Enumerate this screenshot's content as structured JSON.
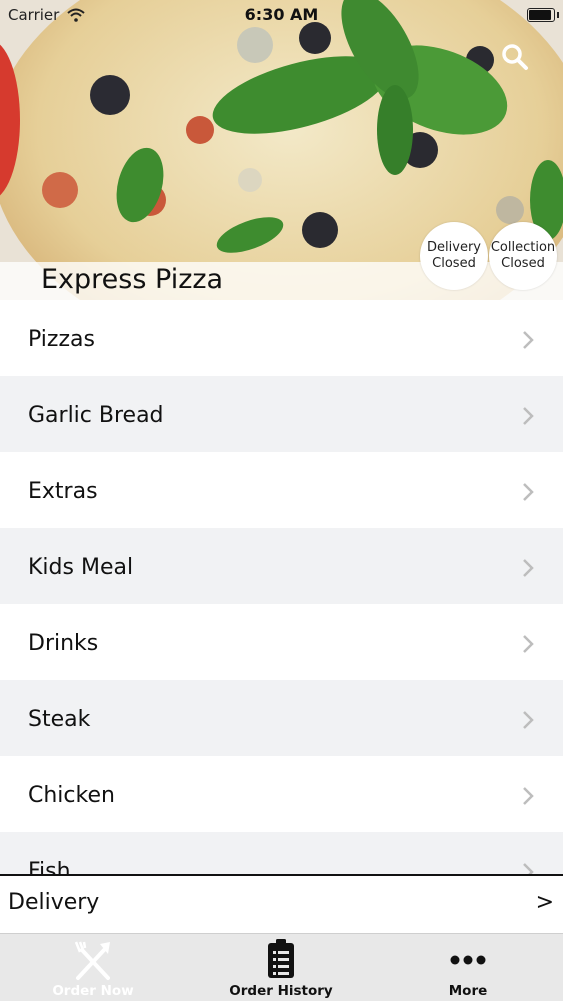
{
  "status_bar": {
    "carrier": "Carrier",
    "time": "6:30 AM",
    "battery_level": 0.9
  },
  "header": {
    "restaurant_name": "Express Pizza",
    "search_icon": "search-icon"
  },
  "badges": {
    "delivery": {
      "line1": "Delivery",
      "line2": "Closed"
    },
    "collection": {
      "line1": "Collection",
      "line2": "Closed"
    }
  },
  "menu": {
    "items": [
      {
        "label": "Pizzas"
      },
      {
        "label": "Garlic Bread"
      },
      {
        "label": "Extras"
      },
      {
        "label": "Kids Meal"
      },
      {
        "label": "Drinks"
      },
      {
        "label": "Steak"
      },
      {
        "label": "Chicken"
      },
      {
        "label": "Fish"
      }
    ]
  },
  "delivery_bar": {
    "label": "Delivery",
    "arrow": ">"
  },
  "tabbar": {
    "tabs": [
      {
        "label": "Order Now",
        "icon": "fork-knife-icon",
        "active": true
      },
      {
        "label": "Order History",
        "icon": "clipboard-list-icon",
        "active": false
      },
      {
        "label": "More",
        "icon": "more-dots-icon",
        "active": false
      }
    ]
  },
  "colors": {
    "accent": "#111111",
    "row_alt": "#f1f2f4",
    "tabbar_bg": "#e8e8e8"
  }
}
